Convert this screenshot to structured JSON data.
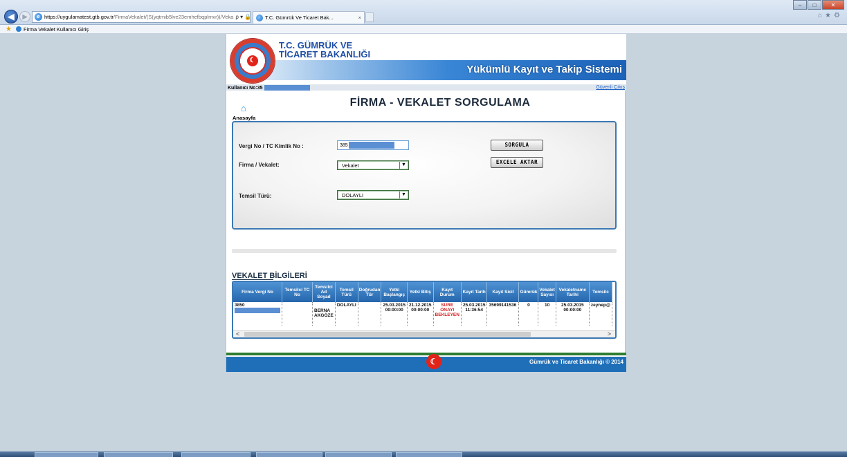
{
  "browser": {
    "url_host": "https://uygulamatest.gtb.gov.tr",
    "url_path": "/FirmaVekalet/(S(yqtmib5lve23emhefbqplmvr))/Veka",
    "url_controls": "ρ ▾ 🔒 C",
    "tab_title": "T.C. Gümrük Ve Ticaret Bak...",
    "tab_close": "×",
    "favorite_label": "Firma Vekalet Kullanıcı Giriş",
    "win_min": "–",
    "win_max": "□",
    "win_close": "✕",
    "right_tools": "⌂★⚙"
  },
  "header": {
    "ministry_line1": "T.C. GÜMRÜK VE",
    "ministry_line2": "TİCARET BAKANLIĞI",
    "system_title": "Yükümlü Kayıt ve Takip Sistemi",
    "user_label": "Kullanıcı No:35",
    "logout_label": "Güvenli Çıkış"
  },
  "nav": {
    "home_label": "Anasayfa"
  },
  "page_title": "FİRMA - VEKALET SORGULAMA",
  "form": {
    "tax_label": "Vergi No / TC Kimlik No :",
    "tax_value": "385",
    "firm_label": "Firma / Vekalet:",
    "firm_value": "Vekalet",
    "rep_label": "Temsil Türü:",
    "rep_value": "DOLAYLI",
    "query_button": "SORGULA",
    "excel_button": "EXCELE AKTAR"
  },
  "section_title": "VEKALET BİLGİLERİ",
  "table": {
    "headers": [
      "Firma Vergi No",
      "Temsilci TC No",
      "Temsilci Ad Soyad",
      "Temsil Türü",
      "Doğrudan Tür",
      "Yetki Başlangıç",
      "Yetki Bitiş",
      "Kayıt Durum",
      "Kayıt Tarih",
      "Kayıt Sicil",
      "Gümrük",
      "Vekalet Sayısı",
      "Vekaletname Tarihi",
      "Temsilc"
    ],
    "row": {
      "firma_vergi_no": "3850",
      "temsilci_tc": "",
      "temsilci_ad": "BERNA AKGÖZE",
      "temsil_turu": "DOLAYLI",
      "dogrudan_tur": "",
      "yetki_baslangic": "25.03.2015 00:00:00",
      "yetki_bitis": "21.12.2015 00:00:00",
      "kayit_durum": "SURE ONAYI BEKLEYEN",
      "kayit_tarih": "25.03.2015 11:36:54",
      "kayit_sicil": "35699141536",
      "gumruk": "0",
      "vekalet_sayisi": "10",
      "vekaletname_tarihi": "25.03.2015 00:00:00",
      "temsilci_email": "zeynep@"
    },
    "scroll_left": "<",
    "scroll_right": ">"
  },
  "footer": {
    "copyright": "Gümrük ve Ticaret Bakanlığı © 2014"
  }
}
